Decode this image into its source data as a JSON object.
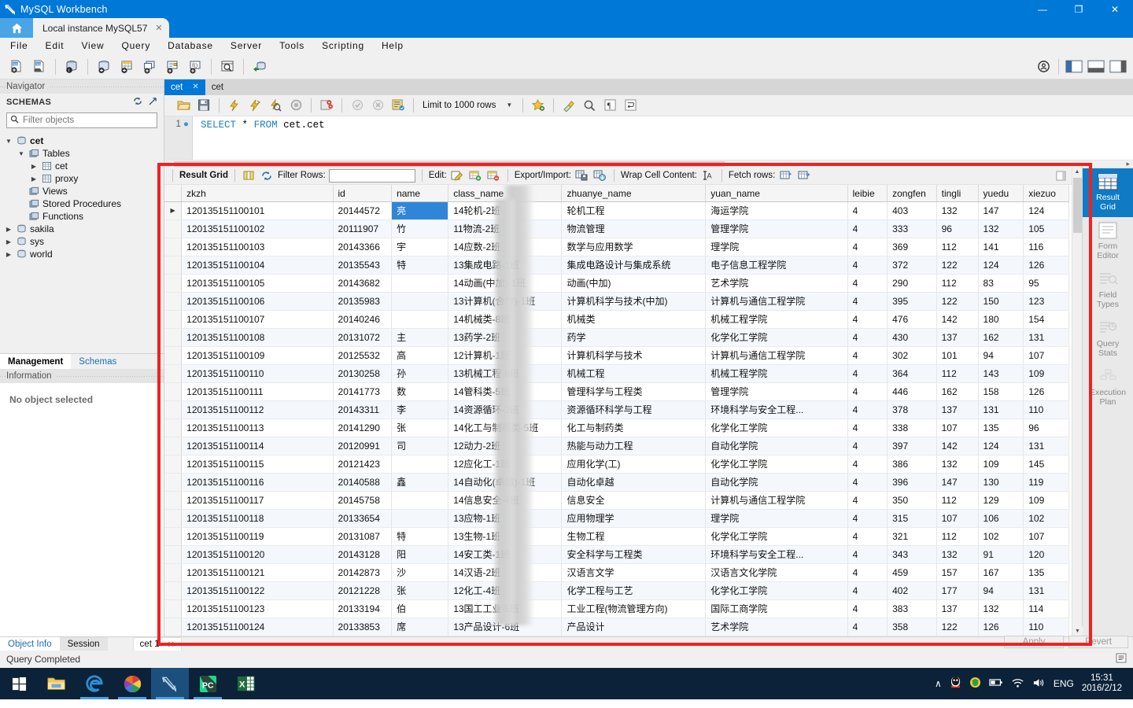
{
  "window": {
    "app_title": "MySQL Workbench",
    "minimize": "—",
    "maximize": "❐",
    "close": "✕"
  },
  "tabs": {
    "home_icon": "home-icon",
    "connection_tab": "Local instance MySQL57",
    "close_glyph": "✕"
  },
  "menu": [
    {
      "label": "File"
    },
    {
      "label": "Edit"
    },
    {
      "label": "View"
    },
    {
      "label": "Query"
    },
    {
      "label": "Database"
    },
    {
      "label": "Server"
    },
    {
      "label": "Tools"
    },
    {
      "label": "Scripting"
    },
    {
      "label": "Help"
    }
  ],
  "navigator": {
    "panel_title": "Navigator",
    "section_title": "SCHEMAS",
    "filter_placeholder": "Filter objects",
    "tree": [
      {
        "label": "cet",
        "indent": 0,
        "arrow": "▼",
        "icon": "schema-icon",
        "bold": true
      },
      {
        "label": "Tables",
        "indent": 1,
        "arrow": "▼",
        "icon": "folder-icon",
        "bold": false
      },
      {
        "label": "cet",
        "indent": 2,
        "arrow": "▶",
        "icon": "table-icon",
        "bold": false
      },
      {
        "label": "proxy",
        "indent": 2,
        "arrow": "▶",
        "icon": "table-icon",
        "bold": false
      },
      {
        "label": "Views",
        "indent": 1,
        "arrow": "",
        "icon": "folder-icon",
        "bold": false
      },
      {
        "label": "Stored Procedures",
        "indent": 1,
        "arrow": "",
        "icon": "folder-icon",
        "bold": false
      },
      {
        "label": "Functions",
        "indent": 1,
        "arrow": "",
        "icon": "folder-icon",
        "bold": false
      },
      {
        "label": "sakila",
        "indent": 0,
        "arrow": "▶",
        "icon": "schema-icon",
        "bold": false
      },
      {
        "label": "sys",
        "indent": 0,
        "arrow": "▶",
        "icon": "schema-icon",
        "bold": false
      },
      {
        "label": "world",
        "indent": 0,
        "arrow": "▶",
        "icon": "schema-icon",
        "bold": false
      }
    ],
    "bottom_tabs": [
      {
        "label": "Management",
        "active": true
      },
      {
        "label": "Schemas",
        "active": false
      }
    ],
    "information_title": "Information",
    "information_empty": "No object selected"
  },
  "editor": {
    "tabs": [
      {
        "label": "cet",
        "active": true,
        "closable": true
      },
      {
        "label": "cet",
        "active": false,
        "closable": false
      }
    ],
    "limit_label": "Limit to 1000 rows",
    "line_number": "1",
    "sql_keywords_1": "SELECT",
    "sql_star": "*",
    "sql_keywords_2": "FROM",
    "sql_target": "cet.cet"
  },
  "result_toolbar": {
    "result_grid_label": "Result Grid",
    "filter_rows_label": "Filter Rows:",
    "filter_value": "",
    "edit_label": "Edit:",
    "export_import_label": "Export/Import:",
    "wrap_cell_label": "Wrap Cell Content:",
    "fetch_rows_label": "Fetch rows:"
  },
  "right_rail": [
    {
      "label": "Result\nGrid",
      "line1": "Result",
      "line2": "Grid",
      "icon": "grid-icon",
      "active": true
    },
    {
      "label": "Form Editor",
      "line1": "Form",
      "line2": "Editor",
      "icon": "form-icon",
      "active": false
    },
    {
      "label": "Field Types",
      "line1": "Field",
      "line2": "Types",
      "icon": "field-types-icon",
      "active": false
    },
    {
      "label": "Query Stats",
      "line1": "Query",
      "line2": "Stats",
      "icon": "query-stats-icon",
      "active": false
    },
    {
      "label": "Execution Plan",
      "line1": "Execution",
      "line2": "Plan",
      "icon": "exec-plan-icon",
      "active": false
    }
  ],
  "grid": {
    "columns": [
      "zkzh",
      "id",
      "name",
      "class_name",
      "zhuanye_name",
      "yuan_name",
      "leibie",
      "zongfen",
      "tingli",
      "yuedu",
      "xiezuo"
    ],
    "rows": [
      [
        "120135151100101",
        "20144572",
        "亮",
        "14轮机-2班",
        "轮机工程",
        "海运学院",
        "4",
        "403",
        "132",
        "147",
        "124"
      ],
      [
        "120135151100102",
        "20111907",
        "竹",
        "11物流-2班",
        "物流管理",
        "管理学院",
        "4",
        "333",
        "96",
        "132",
        "105"
      ],
      [
        "120135151100103",
        "20143366",
        "宇",
        "14应数-2班",
        "数学与应用数学",
        "理学院",
        "4",
        "369",
        "112",
        "141",
        "116"
      ],
      [
        "120135151100104",
        "20135543",
        "特",
        "13集成电路-1班",
        "集成电路设计与集成系统",
        "电子信息工程学院",
        "4",
        "372",
        "122",
        "124",
        "126"
      ],
      [
        "120135151100105",
        "20143682",
        "",
        "14动画(中加)-1班",
        "动画(中加)",
        "艺术学院",
        "4",
        "290",
        "112",
        "83",
        "95"
      ],
      [
        "120135151100106",
        "20135983",
        "",
        "13计算机(合作)-1班",
        "计算机科学与技术(中加)",
        "计算机与通信工程学院",
        "4",
        "395",
        "122",
        "150",
        "123"
      ],
      [
        "120135151100107",
        "20140246",
        "",
        "14机械类-8班",
        "机械类",
        "机械工程学院",
        "4",
        "476",
        "142",
        "180",
        "154"
      ],
      [
        "120135151100108",
        "20131072",
        "主",
        "13药学-2班",
        "药学",
        "化学化工学院",
        "4",
        "430",
        "137",
        "162",
        "131"
      ],
      [
        "120135151100109",
        "20125532",
        "高",
        "12计算机-1班",
        "计算机科学与技术",
        "计算机与通信工程学院",
        "4",
        "302",
        "101",
        "94",
        "107"
      ],
      [
        "120135151100110",
        "20130258",
        "孙",
        "13机械工程-8班",
        "机械工程",
        "机械工程学院",
        "4",
        "364",
        "112",
        "143",
        "109"
      ],
      [
        "120135151100111",
        "20141773",
        "数",
        "14管科类-5班",
        "管理科学与工程类",
        "管理学院",
        "4",
        "446",
        "162",
        "158",
        "126"
      ],
      [
        "120135151100112",
        "20143311",
        "李",
        "14资源循环-2班",
        "资源循环科学与工程",
        "环境科学与安全工程...",
        "4",
        "378",
        "137",
        "131",
        "110"
      ],
      [
        "120135151100113",
        "20141290",
        "张",
        "14化工与制药类-5班",
        "化工与制药类",
        "化学化工学院",
        "4",
        "338",
        "107",
        "135",
        "96"
      ],
      [
        "120135151100114",
        "20120991",
        "司",
        "12动力-2班",
        "热能与动力工程",
        "自动化学院",
        "4",
        "397",
        "142",
        "124",
        "131"
      ],
      [
        "120135151100115",
        "20121423",
        "",
        "12应化工-1班",
        "应用化学(工)",
        "化学化工学院",
        "4",
        "386",
        "132",
        "109",
        "145"
      ],
      [
        "120135151100116",
        "20140588",
        "鑫",
        "14自动化(卓越)-1班",
        "自动化卓越",
        "自动化学院",
        "4",
        "396",
        "147",
        "130",
        "119"
      ],
      [
        "120135151100117",
        "20145758",
        "",
        "14信息安全-4班",
        "信息安全",
        "计算机与通信工程学院",
        "4",
        "350",
        "112",
        "129",
        "109"
      ],
      [
        "120135151100118",
        "20133654",
        "",
        "13应物-1班",
        "应用物理学",
        "理学院",
        "4",
        "315",
        "107",
        "106",
        "102"
      ],
      [
        "120135151100119",
        "20131087",
        "特",
        "13生物-1班",
        "生物工程",
        "化学化工学院",
        "4",
        "321",
        "112",
        "102",
        "107"
      ],
      [
        "120135151100120",
        "20143128",
        "阳",
        "14安工类-1班",
        "安全科学与工程类",
        "环境科学与安全工程...",
        "4",
        "343",
        "132",
        "91",
        "120"
      ],
      [
        "120135151100121",
        "20142873",
        "沙",
        "14汉语-2班",
        "汉语言文学",
        "汉语言文化学院",
        "4",
        "459",
        "157",
        "167",
        "135"
      ],
      [
        "120135151100122",
        "20121228",
        "张",
        "12化工-4班",
        "化学工程与工艺",
        "化学化工学院",
        "4",
        "402",
        "177",
        "94",
        "131"
      ],
      [
        "120135151100123",
        "20133194",
        "伯",
        "13国工工业-5班",
        "工业工程(物流管理方向)",
        "国际工商学院",
        "4",
        "383",
        "137",
        "132",
        "114"
      ],
      [
        "120135151100124",
        "20133853",
        "席",
        "13产品设计-6班",
        "产品设计",
        "艺术学院",
        "4",
        "358",
        "122",
        "126",
        "110"
      ]
    ]
  },
  "footer": {
    "tabs": [
      {
        "label": "Object Info",
        "active": true
      },
      {
        "label": "Session",
        "active": false
      }
    ],
    "result_tab": "cet 1",
    "result_tab_close": "✕",
    "apply_label": "Apply",
    "revert_label": "Revert",
    "status_text": "Query Completed"
  },
  "taskbar": {
    "items": [
      {
        "name": "start-button",
        "icon": "windows-logo-icon"
      },
      {
        "name": "file-explorer",
        "icon": "folder-icon"
      },
      {
        "name": "microsoft-edge",
        "icon": "edge-icon"
      },
      {
        "name": "chrome-like-browser",
        "icon": "pinwheel-icon"
      },
      {
        "name": "mysql-workbench",
        "icon": "workbench-dolphin-icon"
      },
      {
        "name": "pycharm",
        "icon": "pycharm-icon"
      },
      {
        "name": "excel",
        "icon": "excel-icon"
      }
    ],
    "tray": {
      "chevron": "∧",
      "language": "ENG",
      "time": "15:31",
      "date": "2016/2/12"
    }
  },
  "colors": {
    "accent": "#0078d7",
    "title_blue": "#0078d7",
    "annotation_red": "#f32020",
    "selection_blue": "#2f86d9",
    "taskbar": "#0b2239"
  }
}
